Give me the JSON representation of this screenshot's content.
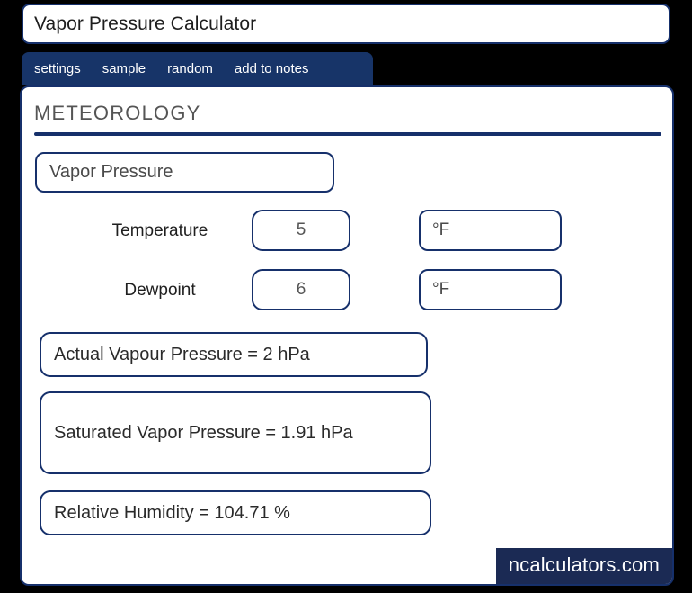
{
  "window": {
    "title": "Vapor Pressure Calculator"
  },
  "tabs": [
    {
      "label": "settings"
    },
    {
      "label": "sample"
    },
    {
      "label": "random"
    },
    {
      "label": "add to notes"
    }
  ],
  "main": {
    "section_title": "METEOROLOGY",
    "calculator_select": {
      "selected": "Vapor Pressure"
    },
    "inputs": [
      {
        "label": "Temperature",
        "value": "5",
        "unit": "°F"
      },
      {
        "label": "Dewpoint",
        "value": "6",
        "unit": "°F"
      }
    ],
    "results": [
      {
        "text": "Actual Vapour Pressure  =  2 hPa"
      },
      {
        "text": "Saturated Vapor Pressure  =  1.91 hPa"
      },
      {
        "text": "Relative Humidity  =  104.71 %"
      }
    ]
  },
  "footer": {
    "watermark": "ncalculators.com"
  },
  "colors": {
    "navy": "#16306b",
    "tab_bar": "#173468",
    "watermark_bg": "#1b2a54",
    "page_background": "#000000",
    "panel_background": "#ffffff"
  }
}
